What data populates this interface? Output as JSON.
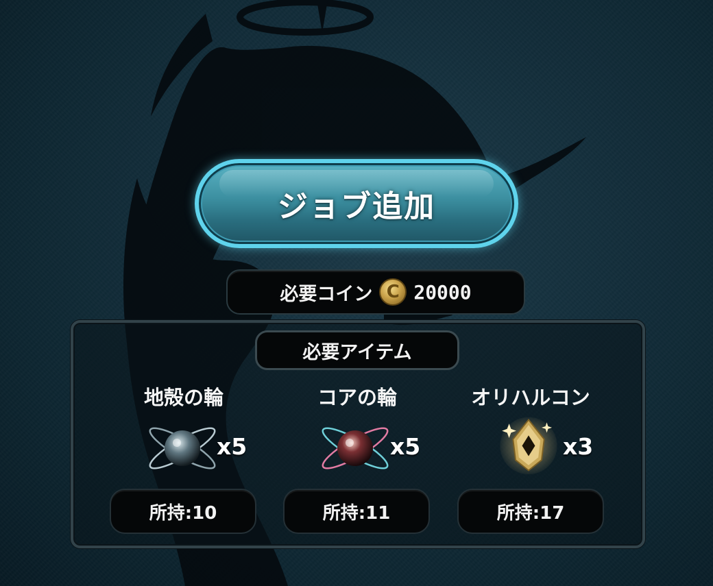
{
  "job_button": {
    "label": "ジョブ追加"
  },
  "coin": {
    "label": "必要コイン",
    "icon_glyph": "C",
    "value": "20000"
  },
  "items_section": {
    "title": "必要アイテム",
    "items": [
      {
        "name": "地殻の輪",
        "icon": "crust-ring-icon",
        "qty": "x5",
        "owned": "所持:10",
        "accent": "#9fb6c0"
      },
      {
        "name": "コアの輪",
        "icon": "core-ring-icon",
        "qty": "x5",
        "owned": "所持:11",
        "accent": "#e07aa0"
      },
      {
        "name": "オリハルコン",
        "icon": "orichalcum-icon",
        "qty": "x3",
        "owned": "所持:17",
        "accent": "#d9b45a"
      }
    ]
  }
}
